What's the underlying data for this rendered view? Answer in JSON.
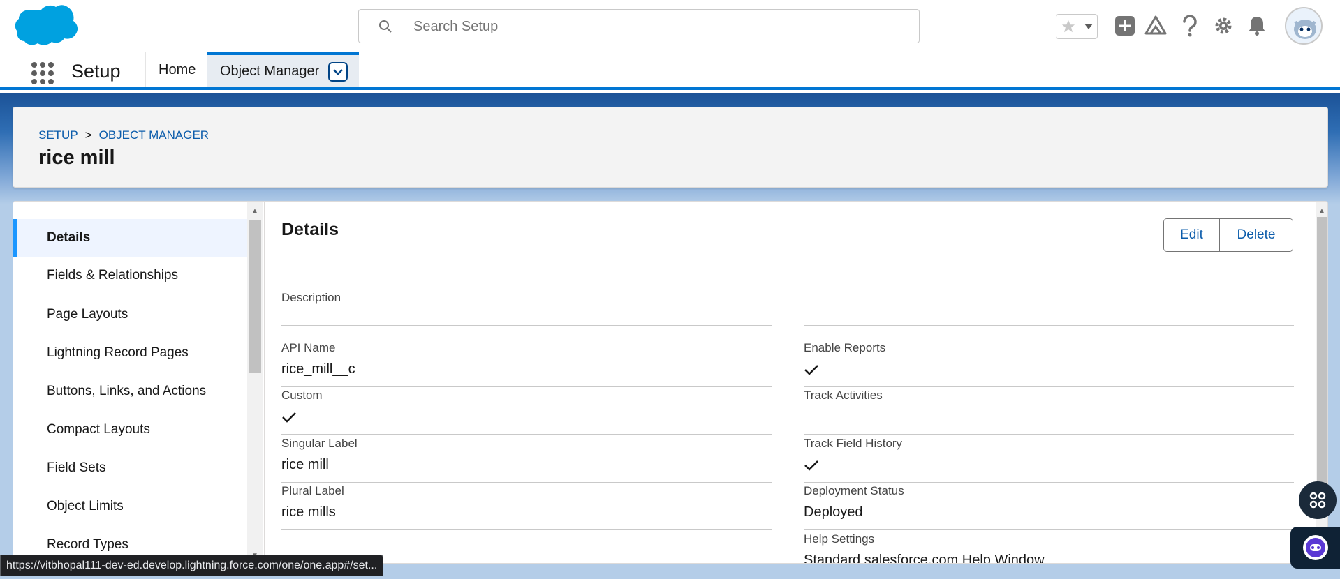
{
  "header": {
    "search_placeholder": "Search Setup",
    "icons": [
      "cloud-logo",
      "search-icon",
      "star-icon",
      "chevron-down-icon",
      "add-icon",
      "trailhead-icon",
      "help-icon",
      "gear-icon",
      "bell-icon",
      "avatar"
    ],
    "brand_color": "#00a1e0"
  },
  "context_bar": {
    "app_name": "Setup",
    "tabs": [
      {
        "label": "Home",
        "active": false
      },
      {
        "label": "Object Manager",
        "active": true
      }
    ]
  },
  "page_header": {
    "breadcrumb": [
      "SETUP",
      "OBJECT MANAGER"
    ],
    "separator": ">",
    "title": "rice mill"
  },
  "sidebar": {
    "items": [
      {
        "label": "Details",
        "active": true
      },
      {
        "label": "Fields & Relationships"
      },
      {
        "label": "Page Layouts"
      },
      {
        "label": "Lightning Record Pages"
      },
      {
        "label": "Buttons, Links, and Actions"
      },
      {
        "label": "Compact Layouts"
      },
      {
        "label": "Field Sets"
      },
      {
        "label": "Object Limits"
      },
      {
        "label": "Record Types"
      }
    ]
  },
  "details": {
    "title": "Details",
    "edit_label": "Edit",
    "delete_label": "Delete",
    "left_fields": [
      {
        "label": "Description",
        "value": ""
      },
      {
        "label": "API Name",
        "value": "rice_mill__c"
      },
      {
        "label": "Custom",
        "checked": true
      },
      {
        "label": "Singular Label",
        "value": "rice mill"
      },
      {
        "label": "Plural Label",
        "value": "rice mills"
      }
    ],
    "right_fields": [
      {
        "label": "Enable Reports",
        "checked": true
      },
      {
        "label": "Track Activities",
        "checked": false
      },
      {
        "label": "Track Field History",
        "checked": true
      },
      {
        "label": "Deployment Status",
        "value": "Deployed"
      },
      {
        "label": "Help Settings",
        "value": "Standard salesforce.com Help Window"
      }
    ]
  },
  "status_bar": {
    "url": "https://vitbhopal111-dev-ed.develop.lightning.force.com/one/one.app#/set..."
  }
}
